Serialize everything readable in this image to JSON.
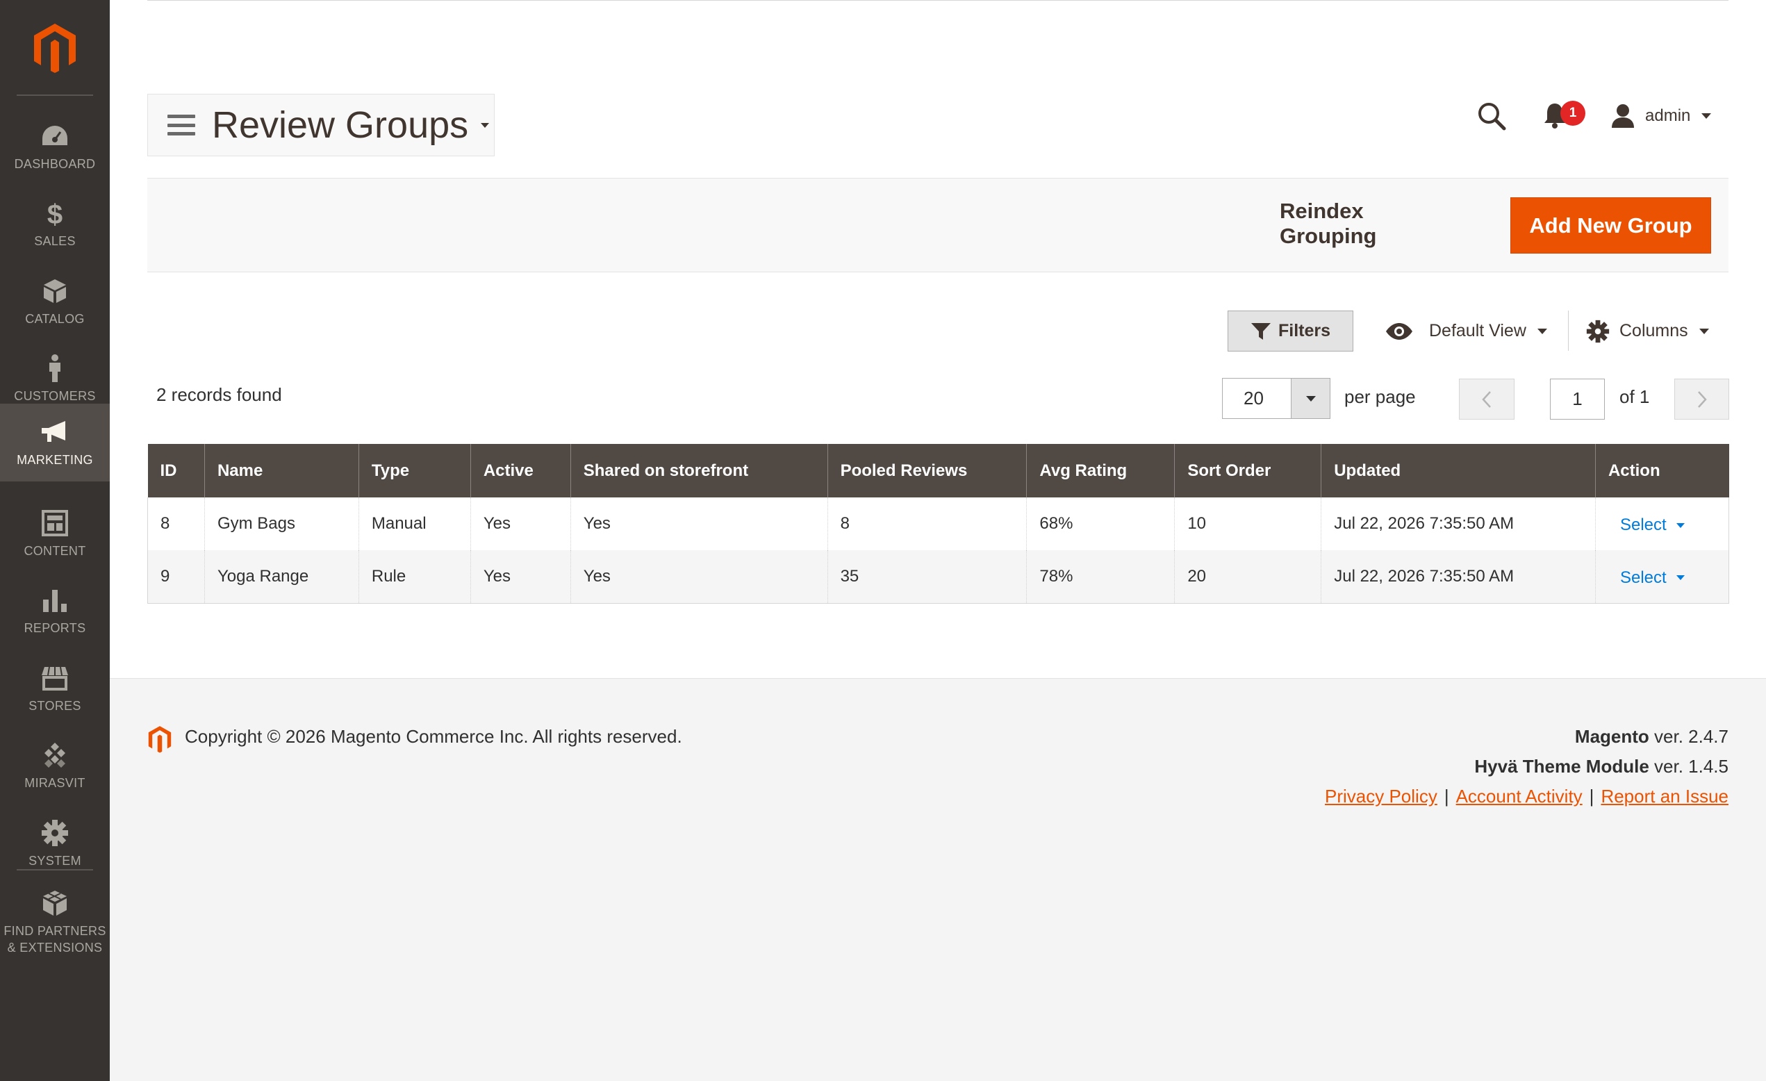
{
  "sidebar": {
    "items": [
      {
        "label": "DASHBOARD",
        "icon": "dashboard-icon"
      },
      {
        "label": "SALES",
        "icon": "dollar-icon"
      },
      {
        "label": "CATALOG",
        "icon": "cube-icon"
      },
      {
        "label": "CUSTOMERS",
        "icon": "person-icon"
      },
      {
        "label": "MARKETING",
        "icon": "megaphone-icon",
        "active": true
      },
      {
        "label": "CONTENT",
        "icon": "layout-icon"
      },
      {
        "label": "REPORTS",
        "icon": "bar-chart-icon"
      },
      {
        "label": "STORES",
        "icon": "store-icon"
      },
      {
        "label": "MIRASVIT",
        "icon": "mirasvit-icon"
      },
      {
        "label": "SYSTEM",
        "icon": "gear-icon"
      },
      {
        "label": "FIND PARTNERS & EXTENSIONS",
        "icon": "blocks-icon"
      }
    ]
  },
  "header": {
    "title": "Review Groups",
    "notification_count": "1",
    "user": "admin"
  },
  "actions": {
    "reindex_label": "Reindex Grouping",
    "add_label": "Add New Group"
  },
  "toolbar": {
    "filters_label": "Filters",
    "view_label": "Default View",
    "columns_label": "Columns",
    "records_found": "2 records found",
    "per_page_value": "20",
    "per_page_label": "per page",
    "page_value": "1",
    "page_of": "of 1"
  },
  "grid": {
    "columns": [
      "ID",
      "Name",
      "Type",
      "Active",
      "Shared on storefront",
      "Pooled Reviews",
      "Avg Rating",
      "Sort Order",
      "Updated",
      "Action"
    ],
    "rows": [
      {
        "id": "8",
        "name": "Gym Bags",
        "type": "Manual",
        "active": "Yes",
        "shared": "Yes",
        "pooled": "8",
        "avg": "68%",
        "sort": "10",
        "updated": "Jul 22, 2026 7:35:50 AM",
        "action": "Select"
      },
      {
        "id": "9",
        "name": "Yoga Range",
        "type": "Rule",
        "active": "Yes",
        "shared": "Yes",
        "pooled": "35",
        "avg": "78%",
        "sort": "20",
        "updated": "Jul 22, 2026 7:35:50 AM",
        "action": "Select"
      }
    ]
  },
  "footer": {
    "copyright": "Copyright © 2026 Magento Commerce Inc. All rights reserved.",
    "magento_name": "Magento",
    "magento_ver": " ver. 2.4.7",
    "hyva_name": "Hyvä Theme Module",
    "hyva_ver": " ver. 1.4.5",
    "privacy": "Privacy Policy",
    "activity": " Account Activity",
    "report": "Report an Issue",
    "sep": "|"
  },
  "colors": {
    "brand": "#eb5202",
    "sidebar_bg": "#373330",
    "table_header": "#514943",
    "link": "#007bdb"
  }
}
